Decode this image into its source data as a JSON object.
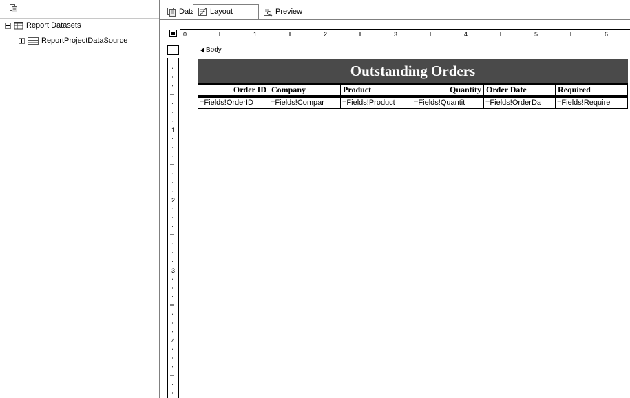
{
  "left_pane": {
    "toolbar_icon": "datasource-icon",
    "tree": {
      "root_label": "Report Datasets",
      "child_label": "ReportProjectDataSource"
    }
  },
  "tabs": [
    {
      "label": "Data",
      "icon": "data-tab-icon",
      "active": false
    },
    {
      "label": "Layout",
      "icon": "layout-tab-icon",
      "active": true
    },
    {
      "label": "Preview",
      "icon": "preview-tab-icon",
      "active": false
    }
  ],
  "ruler": {
    "h_numbers": [
      "0",
      "1",
      "2",
      "3",
      "4",
      "5",
      "6"
    ],
    "v_numbers": [
      "1",
      "2",
      "3",
      "4"
    ]
  },
  "body_label": "Body",
  "report": {
    "title": "Outstanding Orders",
    "headers": [
      "Order ID",
      "Company",
      "Product",
      "Quantity",
      "Order Date",
      "Required"
    ],
    "fields": [
      "=Fields!OrderID",
      "=Fields!Compar",
      "=Fields!Product",
      "=Fields!Quantit",
      "=Fields!OrderDa",
      "=Fields!Require"
    ]
  },
  "colors": {
    "title_bg": "#4a4a4a",
    "title_fg": "#ffffff",
    "border": "#000000"
  }
}
